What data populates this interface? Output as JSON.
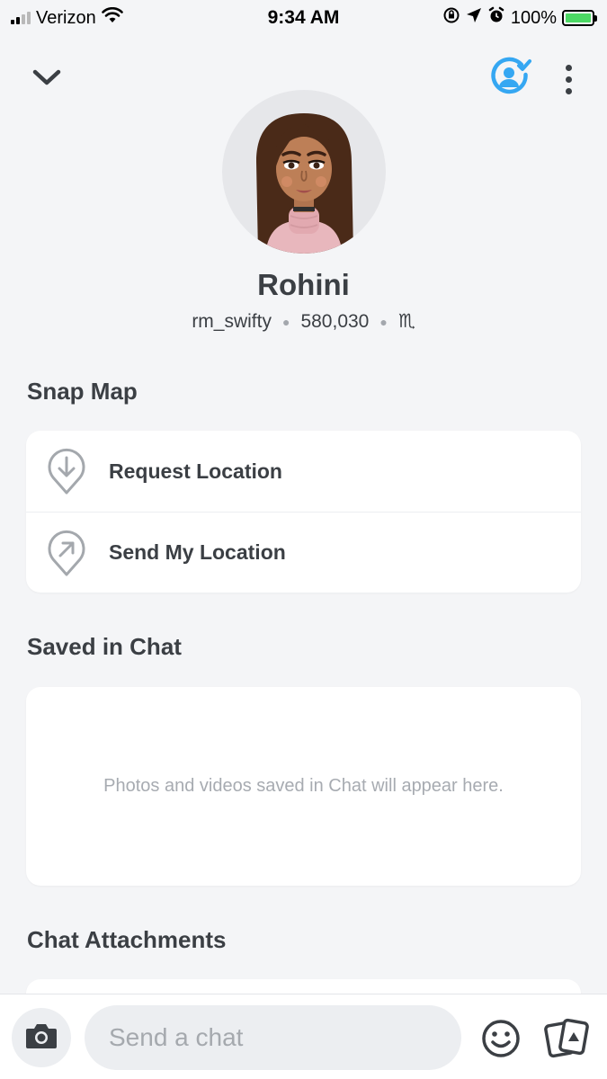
{
  "status_bar": {
    "carrier": "Verizon",
    "time": "9:34 AM",
    "battery": "100%"
  },
  "profile": {
    "name": "Rohini",
    "username": "rm_swifty",
    "score": "580,030",
    "zodiac": "♏"
  },
  "snap_map": {
    "title": "Snap Map",
    "request_label": "Request Location",
    "send_label": "Send My Location"
  },
  "saved_in_chat": {
    "title": "Saved in Chat",
    "empty_text": "Photos and videos saved in Chat will appear here."
  },
  "chat_attachments": {
    "title": "Chat Attachments"
  },
  "composer": {
    "placeholder": "Send a chat"
  },
  "colors": {
    "accent": "#35a7f2",
    "background": "#f4f5f7",
    "text": "#3b3f44",
    "muted": "#a7abb1",
    "battery": "#4cd964"
  },
  "icons": [
    "signal-icon",
    "wifi-icon",
    "orientation-lock-icon",
    "location-arrow-icon",
    "alarm-icon",
    "battery-icon",
    "chevron-down-icon",
    "friend-check-icon",
    "more-icon",
    "request-location-icon",
    "send-location-icon",
    "camera-icon",
    "emoji-icon",
    "cards-icon"
  ]
}
